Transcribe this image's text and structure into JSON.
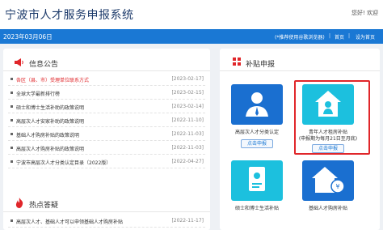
{
  "header": {
    "site_title": "宁波市人才服务申报系统",
    "greeting": "您好! 欢迎"
  },
  "topbar": {
    "date": "2023年03月06日",
    "links": [
      "(*推荐使用谷歌浏览器)",
      "首页",
      "设为首页"
    ]
  },
  "announcements": {
    "title": "信息公告",
    "items": [
      {
        "title": "各区（县、市）受理单位联系方式",
        "date": "[2023-02-17]",
        "highlight": true
      },
      {
        "title": "全球大学最新排行榜",
        "date": "[2023-02-15]"
      },
      {
        "title": "硕士和博士生活补助的政策说明",
        "date": "[2023-02-14]"
      },
      {
        "title": "高层次人才安家补助的政策说明",
        "date": "[2022-11-10]"
      },
      {
        "title": "基础人才购房补贴的政策说明",
        "date": "[2022-11-03]"
      },
      {
        "title": "高层次人才购房补贴的政策说明",
        "date": "[2022-11-03]"
      },
      {
        "title": "宁波市高层次人才分类认定目录（2022版）",
        "date": "[2022-04-27]"
      }
    ]
  },
  "hot_qa": {
    "title": "热点答疑",
    "items": [
      {
        "title": "高层次人才、基础人才可以申领基础人才购房补贴",
        "date": "[2022-11-17]"
      }
    ]
  },
  "subsidy": {
    "title": "补贴申报",
    "cards": [
      {
        "caption": "高层次人才分类认定",
        "button": "点击申报"
      },
      {
        "caption": "青年人才租房补贴",
        "caption2": "(申报期为每月21日至月底)",
        "button": "点击申报"
      },
      {
        "caption": "硕士和博士生活补贴",
        "button": ""
      },
      {
        "caption": "基础人才购房补贴",
        "button": ""
      }
    ]
  },
  "colors": {
    "brand_blue": "#1a78d4",
    "tile_blue": "#1a6fd0",
    "tile_teal": "#1cc0de",
    "alert_red": "#e0262a"
  }
}
